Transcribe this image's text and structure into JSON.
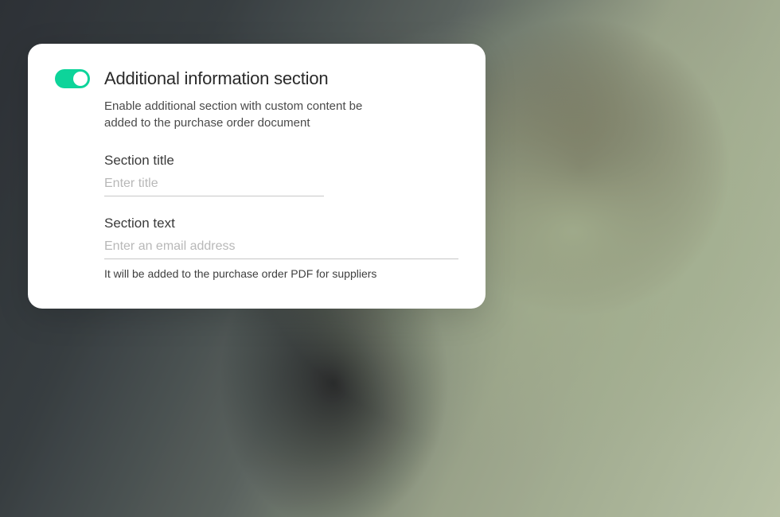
{
  "card": {
    "title": "Additional information section",
    "description": "Enable additional section with custom content be added to the purchase order document",
    "toggle_on": true,
    "colors": {
      "accent": "#0dd49a"
    },
    "fields": {
      "section_title": {
        "label": "Section title",
        "placeholder": "Enter title",
        "value": ""
      },
      "section_text": {
        "label": "Section text",
        "placeholder": "Enter an email address",
        "value": "",
        "help": "It will be added to the purchase order PDF for suppliers"
      }
    }
  }
}
